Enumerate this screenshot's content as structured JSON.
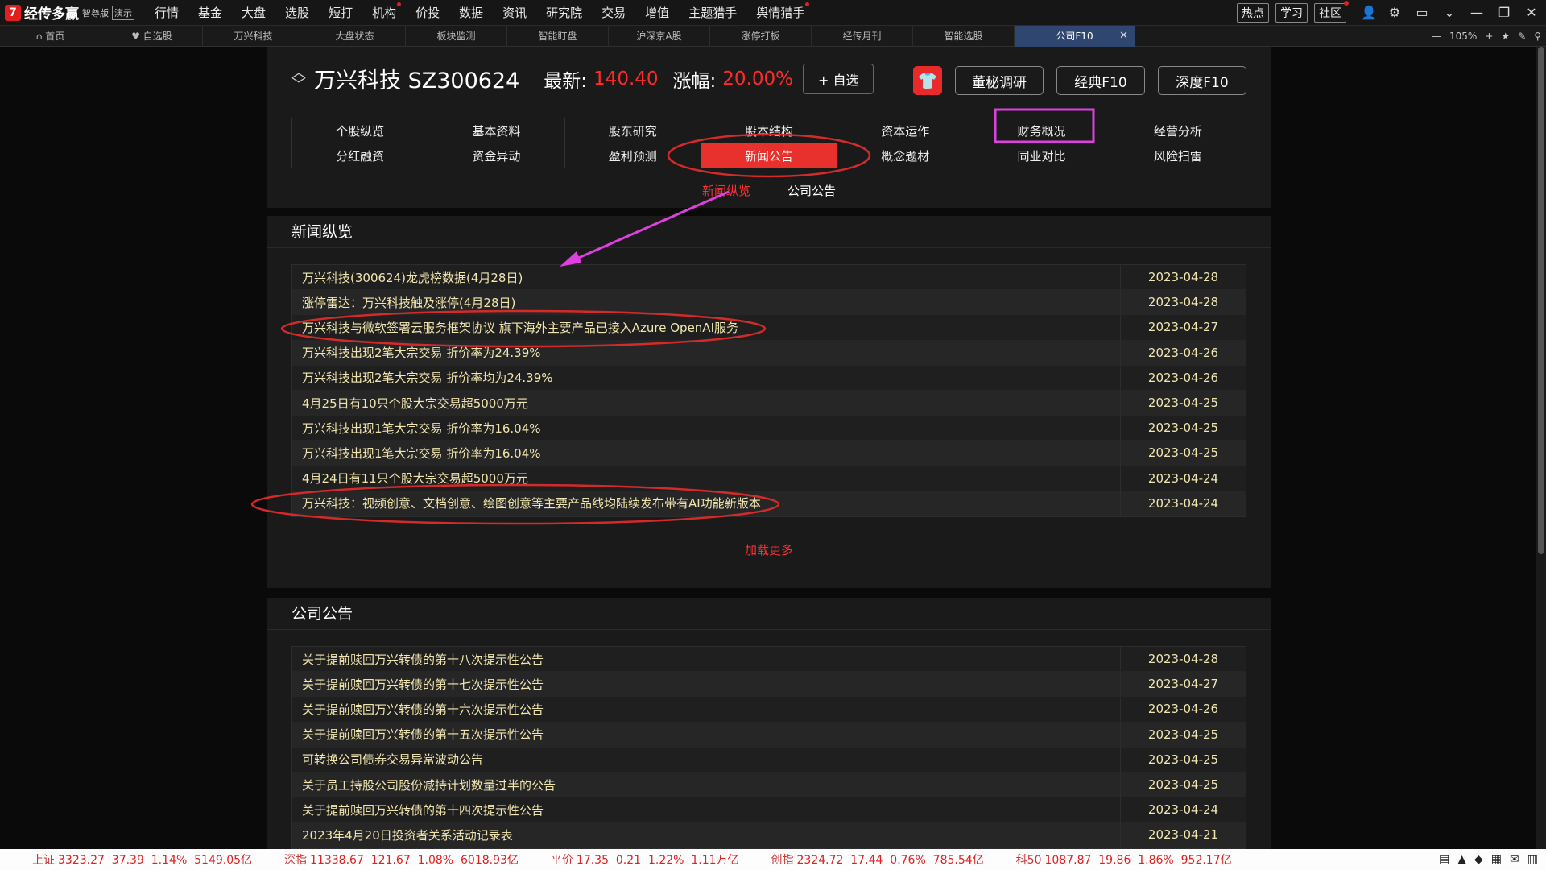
{
  "app": {
    "logo_mark": "7",
    "name": "经传多赢",
    "edition": "智尊版",
    "demo": "演示"
  },
  "menu": [
    {
      "label": "行情",
      "dot": false
    },
    {
      "label": "基金",
      "dot": false
    },
    {
      "label": "大盘",
      "dot": false
    },
    {
      "label": "选股",
      "dot": false
    },
    {
      "label": "短打",
      "dot": false
    },
    {
      "label": "机构",
      "dot": true
    },
    {
      "label": "价投",
      "dot": false
    },
    {
      "label": "数据",
      "dot": false
    },
    {
      "label": "资讯",
      "dot": false
    },
    {
      "label": "研究院",
      "dot": false
    },
    {
      "label": "交易",
      "dot": false
    },
    {
      "label": "增值",
      "dot": false
    },
    {
      "label": "主题猎手",
      "dot": false
    },
    {
      "label": "舆情猎手",
      "dot": true
    }
  ],
  "top_buttons": [
    "热点",
    "学习",
    "社区"
  ],
  "tabs": [
    "首页",
    "自选股",
    "万兴科技",
    "大盘状态",
    "板块监测",
    "智能盯盘",
    "沪深京A股",
    "涨停打板",
    "经传月刊",
    "智能选股"
  ],
  "active_tab": "公司F10",
  "tab_close": "✕",
  "zoom": "105%",
  "stock": {
    "name_code": "万兴科技 SZ300624",
    "latest_label": "最新:",
    "latest": "140.40",
    "change_label": "涨幅:",
    "change": "20.00%",
    "add_watch": "+ 自选",
    "btn_dongmi": "董秘调研",
    "btn_classic": "经典F10",
    "btn_deep": "深度F10"
  },
  "nav": [
    "个股纵览",
    "基本资料",
    "股东研究",
    "股本结构",
    "资本运作",
    "财务概况",
    "经营分析",
    "分红融资",
    "资金异动",
    "盈利预测",
    "新闻公告",
    "概念题材",
    "同业对比",
    "风险扫雷"
  ],
  "nav_active": "新闻公告",
  "subtabs": [
    "新闻纵览",
    "公司公告"
  ],
  "news": {
    "title": "新闻纵览",
    "rows": [
      {
        "title": "万兴科技(300624)龙虎榜数据(4月28日)",
        "date": "2023-04-28"
      },
      {
        "title": "涨停雷达：万兴科技触及涨停(4月28日)",
        "date": "2023-04-28"
      },
      {
        "title": "万兴科技与微软签署云服务框架协议 旗下海外主要产品已接入Azure OpenAI服务",
        "date": "2023-04-27"
      },
      {
        "title": "万兴科技出现2笔大宗交易 折价率为24.39%",
        "date": "2023-04-26"
      },
      {
        "title": "万兴科技出现2笔大宗交易 折价率均为24.39%",
        "date": "2023-04-26"
      },
      {
        "title": "4月25日有10只个股大宗交易超5000万元",
        "date": "2023-04-25"
      },
      {
        "title": "万兴科技出现1笔大宗交易 折价率为16.04%",
        "date": "2023-04-25"
      },
      {
        "title": "万兴科技出现1笔大宗交易 折价率为16.04%",
        "date": "2023-04-25"
      },
      {
        "title": "4月24日有11只个股大宗交易超5000万元",
        "date": "2023-04-24"
      },
      {
        "title": "万兴科技：视频创意、文档创意、绘图创意等主要产品线均陆续发布带有AI功能新版本",
        "date": "2023-04-24"
      }
    ],
    "load_more": "加载更多"
  },
  "announcements": {
    "title": "公司公告",
    "rows": [
      {
        "title": "关于提前赎回万兴转债的第十八次提示性公告",
        "date": "2023-04-28"
      },
      {
        "title": "关于提前赎回万兴转债的第十七次提示性公告",
        "date": "2023-04-27"
      },
      {
        "title": "关于提前赎回万兴转债的第十六次提示性公告",
        "date": "2023-04-26"
      },
      {
        "title": "关于提前赎回万兴转债的第十五次提示性公告",
        "date": "2023-04-25"
      },
      {
        "title": "可转换公司债券交易异常波动公告",
        "date": "2023-04-25"
      },
      {
        "title": "关于员工持股公司股份减持计划数量过半的公告",
        "date": "2023-04-25"
      },
      {
        "title": "关于提前赎回万兴转债的第十四次提示性公告",
        "date": "2023-04-24"
      },
      {
        "title": "2023年4月20日投资者关系活动记录表",
        "date": "2023-04-21"
      }
    ]
  },
  "status_indices": [
    {
      "name": "上证",
      "values": "3323.27  37.39  1.14%  5149.05亿"
    },
    {
      "name": "深指",
      "values": "11338.67  121.67  1.08%  6018.93亿"
    },
    {
      "name": "平价",
      "values": "17.35  0.21  1.22%  1.11万亿"
    },
    {
      "name": "创指",
      "values": "2324.72  17.44  0.76%  785.54亿"
    },
    {
      "name": "科50",
      "values": "1087.87  19.86  1.86%  952.17亿"
    }
  ],
  "colors": {
    "accent_red": "#e8302c",
    "annotation_red": "#d42a2a",
    "annotation_magenta": "#e040e0",
    "news_text": "#f2e6b0"
  }
}
